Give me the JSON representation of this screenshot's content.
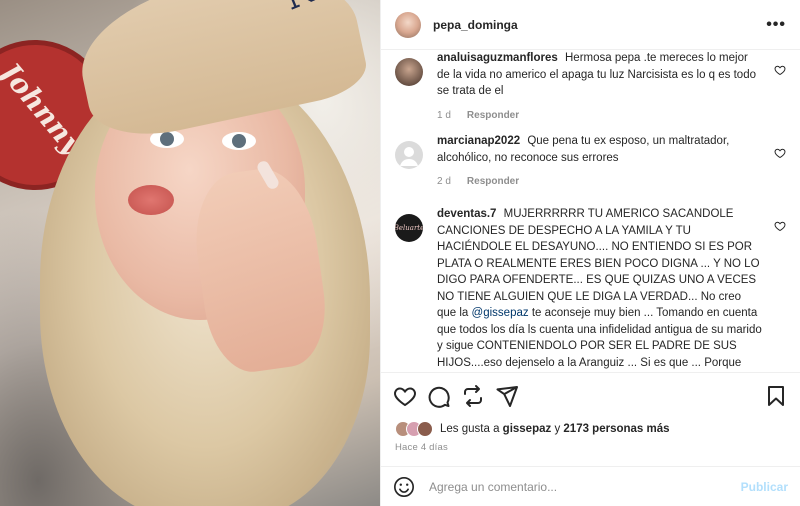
{
  "post": {
    "username": "pepa_dominga",
    "more_label": "•••"
  },
  "comments": [
    {
      "author": "analuisaguzmanflores",
      "text": "Hermosa pepa .te mereces lo mejor de la vida no americo el apaga tu luz Narcisista es lo q es todo se trata de el",
      "age": "1 d",
      "reply_label": "Responder"
    },
    {
      "author": "marcianap2022",
      "text": "Que pena tu ex esposo, un maltratador, alcohólico, no reconoce sus errores",
      "age": "2 d",
      "reply_label": "Responder"
    },
    {
      "author": "deventas.7",
      "text_before": "MUJERRRRRR TU AMERICO SACANDOLE CANCIONES DE DESPECHO A LA YAMILA Y TU HACIÉNDOLE EL DESAYUNO.... NO ENTIENDO SI ES POR PLATA O REALMENTE ERES BIEN POCO DIGNA ... Y NO LO DIGO PARA OFENDERTE... ES QUE QUIZAS UNO A VECES NO TIENE ALGUIEN QUE LE DIGA LA VERDAD... No creo que la",
      "mention": "@gissepaz",
      "text_after": "te aconseje muy bien ... Tomando en cuenta que todos los día ls cuenta una infidelidad antigua de su marido y sigue CONTENIENDOLO POR SER EL PADRE DE SUS HIJOS....eso dejenselo a la Aranguiz ... Si es que ... Porque hasta ella parece q ya entendió como es la cosa ....",
      "avatar_text": "Beluarte"
    }
  ],
  "likes": {
    "prefix": "Les gusta a",
    "user": "gissepaz",
    "connector": "y",
    "count": "2173 personas más"
  },
  "date": "Hace 4 días",
  "composer": {
    "placeholder": "Agrega un comentario...",
    "post_label": "Publicar"
  },
  "photo": {
    "sign_text": "Johnny",
    "cap_logo": "NY"
  },
  "colors": {
    "link": "#00376b",
    "muted": "#8e8e8e",
    "post_button_disabled": "#b2dffc"
  },
  "icons": [
    "heart-icon",
    "comment-icon",
    "share-icon",
    "send-icon",
    "bookmark-icon",
    "emoji-icon",
    "more-icon",
    "user-placeholder-icon"
  ]
}
